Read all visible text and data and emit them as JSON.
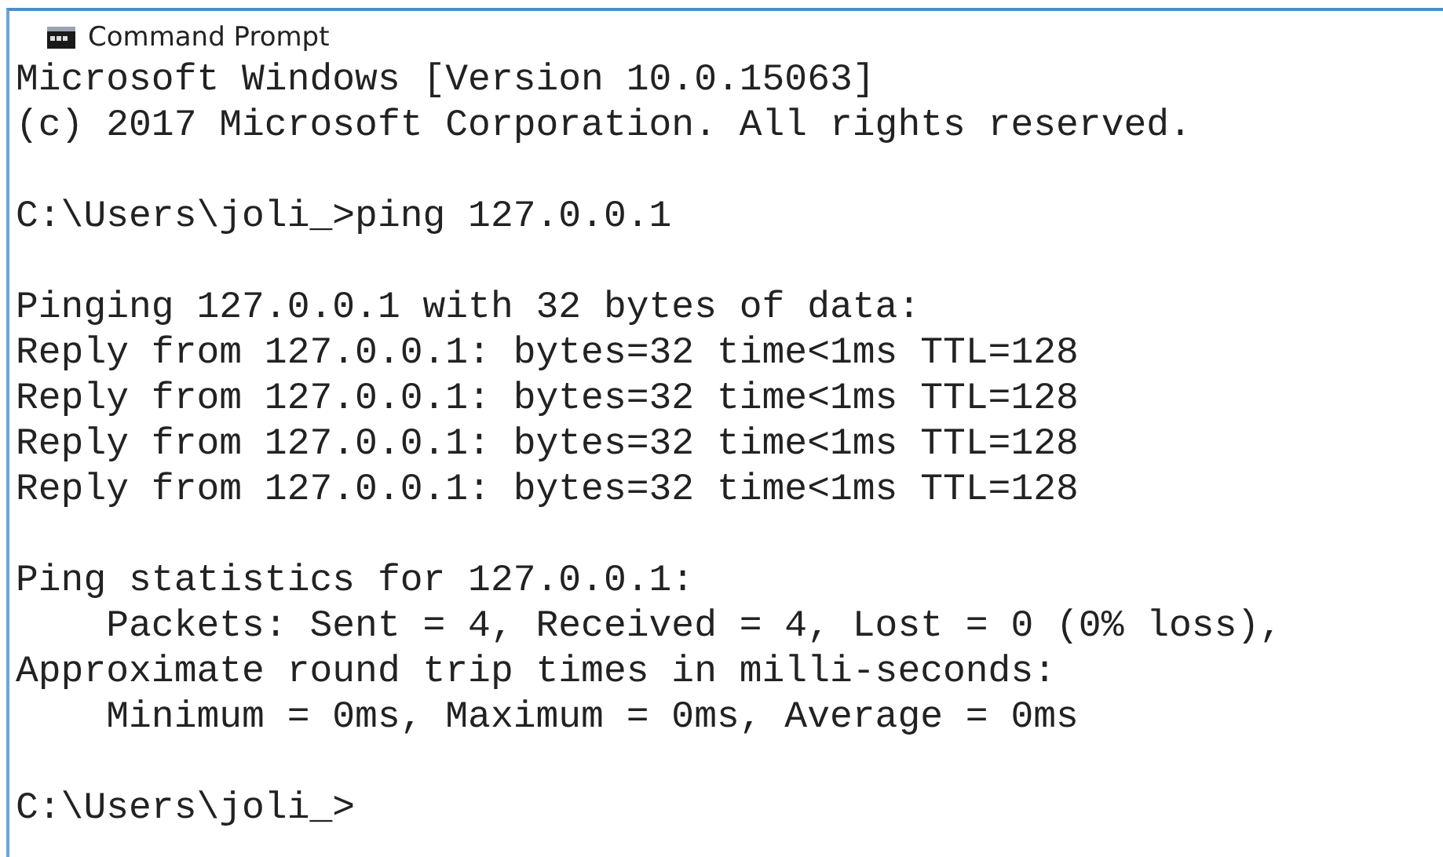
{
  "window": {
    "title": "Command Prompt"
  },
  "console": {
    "blocks": [
      [
        "Microsoft Windows [Version 10.0.15063]",
        "(c) 2017 Microsoft Corporation. All rights reserved."
      ],
      [
        "C:\\Users\\joli_>ping 127.0.0.1"
      ],
      [
        "Pinging 127.0.0.1 with 32 bytes of data:",
        "Reply from 127.0.0.1: bytes=32 time<1ms TTL=128",
        "Reply from 127.0.0.1: bytes=32 time<1ms TTL=128",
        "Reply from 127.0.0.1: bytes=32 time<1ms TTL=128",
        "Reply from 127.0.0.1: bytes=32 time<1ms TTL=128"
      ],
      [
        "Ping statistics for 127.0.0.1:",
        "    Packets: Sent = 4, Received = 4, Lost = 0 (0% loss),",
        "Approximate round trip times in milli-seconds:",
        "    Minimum = 0ms, Maximum = 0ms, Average = 0ms"
      ],
      [
        "C:\\Users\\joli_>"
      ]
    ]
  }
}
